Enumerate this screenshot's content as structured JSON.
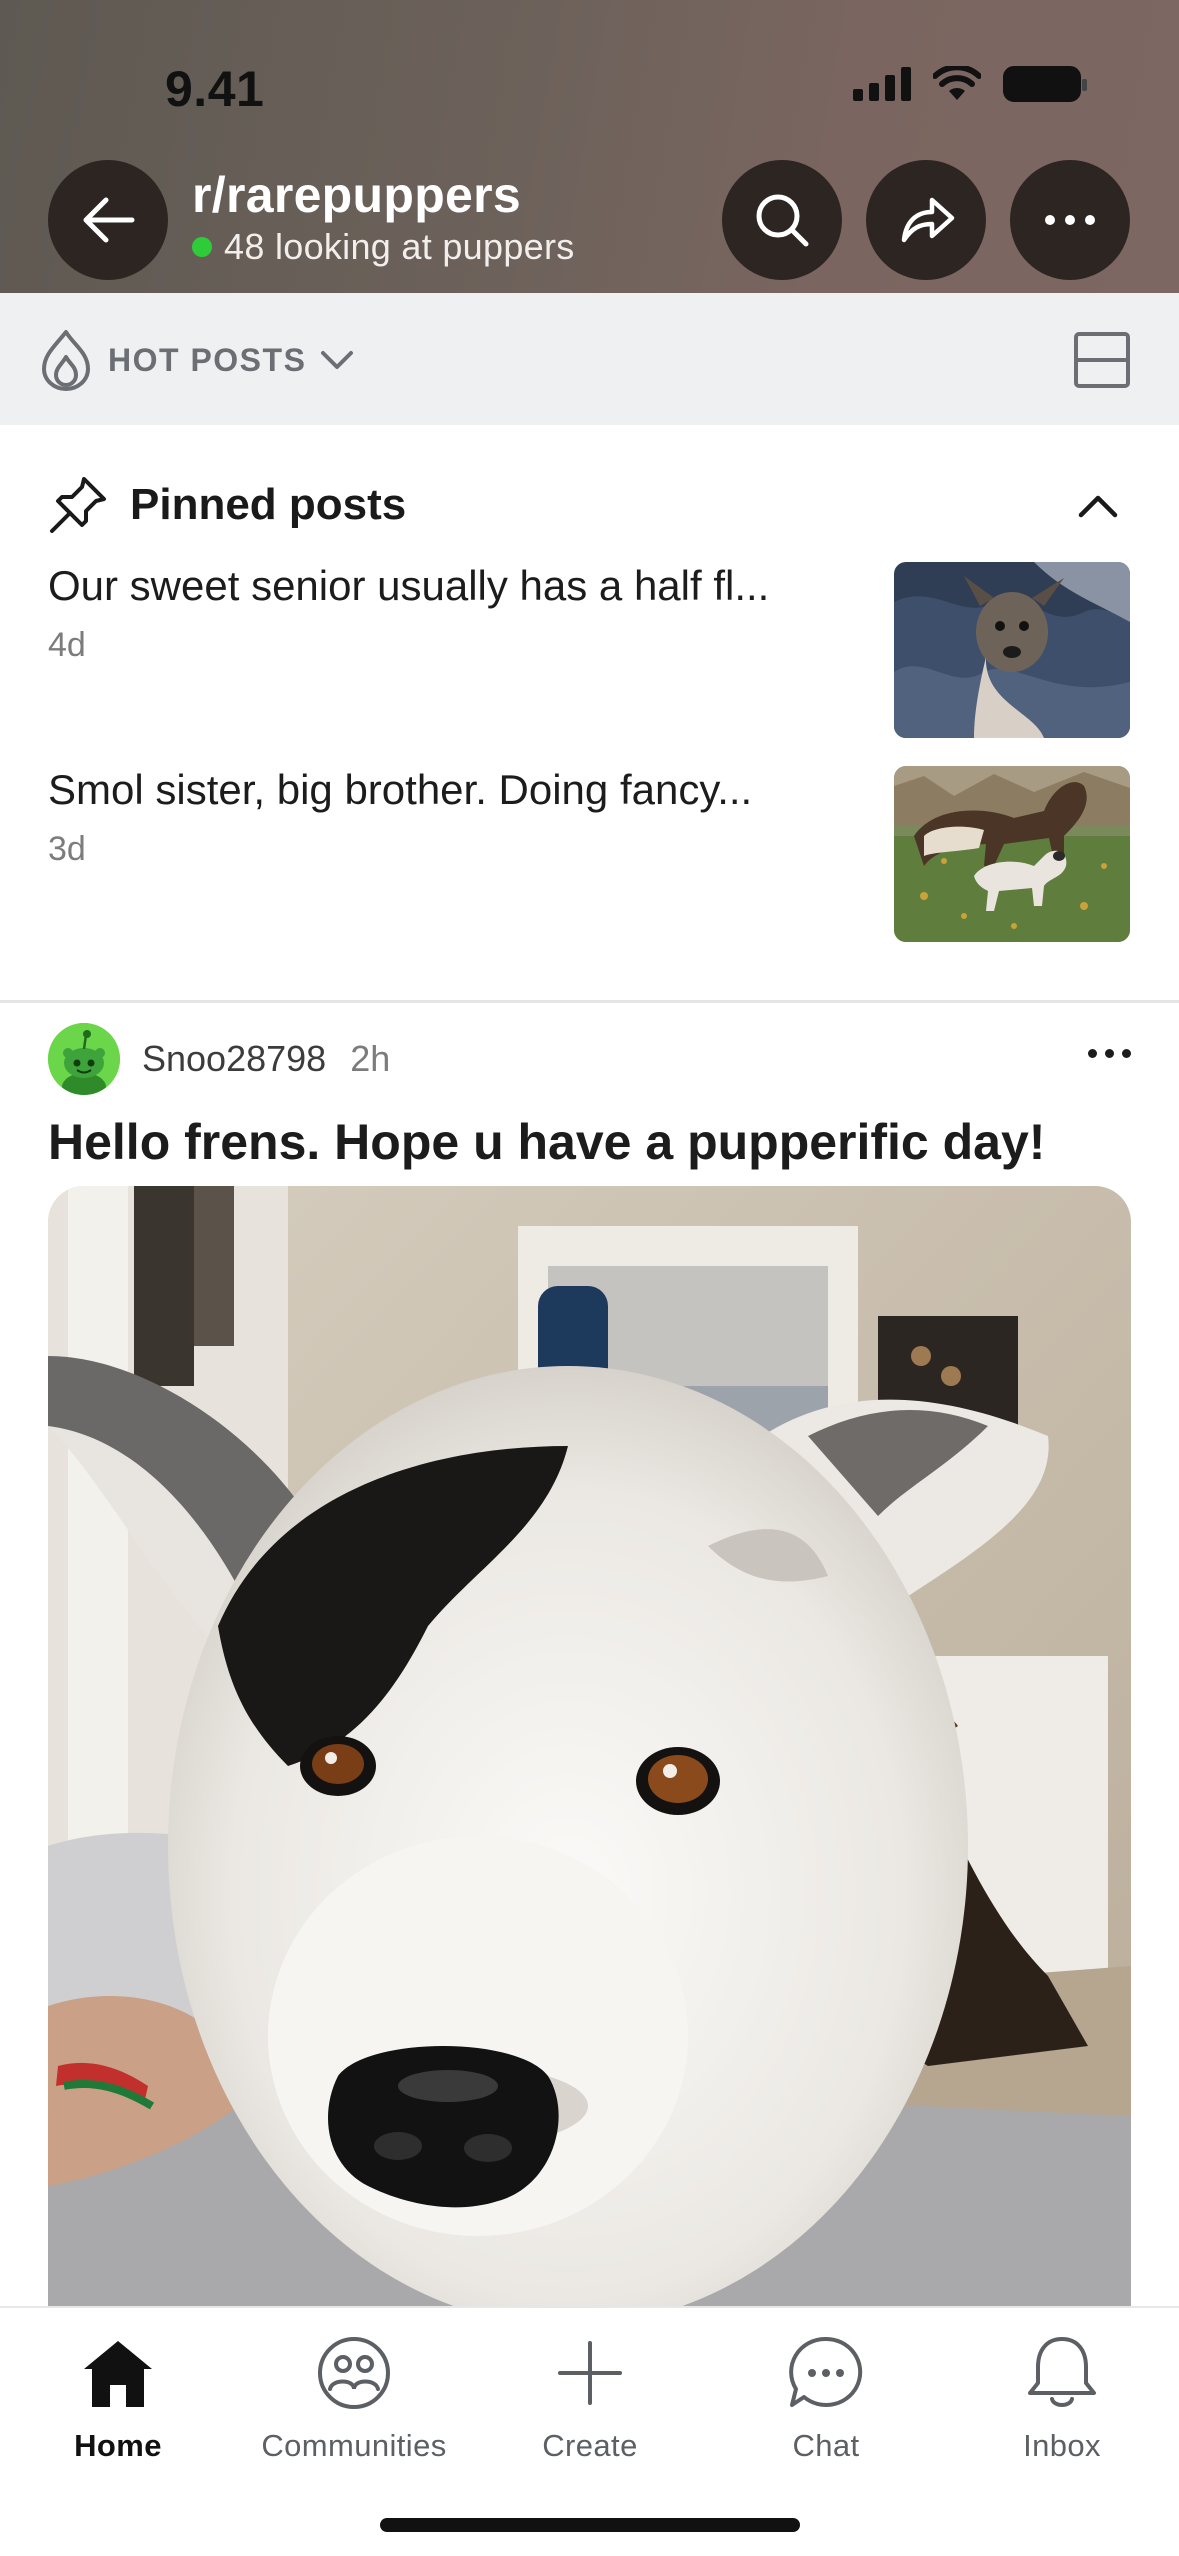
{
  "status_bar": {
    "time": "9.41"
  },
  "header": {
    "subreddit": "r/rarepuppers",
    "online_text": "48 looking at puppers",
    "icons": {
      "back": "back-arrow-icon",
      "search": "search-icon",
      "share": "share-icon",
      "more": "more-icon"
    }
  },
  "sort": {
    "label": "HOT POSTS",
    "icon": "flame-icon",
    "view_icon": "card-layout-icon"
  },
  "pinned": {
    "title": "Pinned posts",
    "items": [
      {
        "text": "Our sweet senior usually has a half fl...",
        "age": "4d"
      },
      {
        "text": "Smol sister, big brother. Doing fancy...",
        "age": "3d"
      }
    ]
  },
  "post": {
    "user": "Snoo28798",
    "age": "2h",
    "title": "Hello frens. Hope u have a pupperific day!"
  },
  "nav": {
    "items": [
      {
        "label": "Home",
        "icon": "home-icon"
      },
      {
        "label": "Communities",
        "icon": "communities-icon"
      },
      {
        "label": "Create",
        "icon": "plus-icon"
      },
      {
        "label": "Chat",
        "icon": "chat-icon"
      },
      {
        "label": "Inbox",
        "icon": "bell-icon"
      }
    ]
  },
  "colors": {
    "online": "#2fcc3a",
    "header_button": "#2c2522",
    "sort_bar": "#eff0f2"
  }
}
